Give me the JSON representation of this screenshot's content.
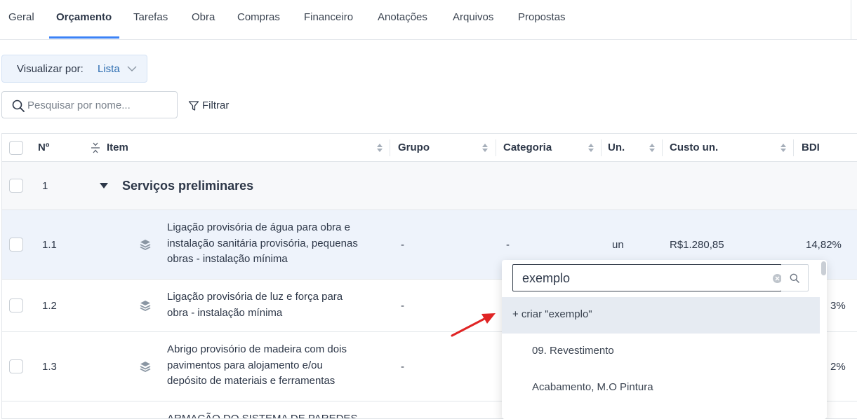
{
  "tabs": [
    {
      "label": "Geral",
      "active": false
    },
    {
      "label": "Orçamento",
      "active": true
    },
    {
      "label": "Tarefas",
      "active": false
    },
    {
      "label": "Obra",
      "active": false
    },
    {
      "label": "Compras",
      "active": false
    },
    {
      "label": "Financeiro",
      "active": false
    },
    {
      "label": "Anotações",
      "active": false
    },
    {
      "label": "Arquivos",
      "active": false
    },
    {
      "label": "Propostas",
      "active": false
    }
  ],
  "view_toggle": {
    "label": "Visualizar por:",
    "value": "Lista"
  },
  "search": {
    "placeholder": "Pesquisar por nome...",
    "value": ""
  },
  "filter": {
    "label": "Filtrar"
  },
  "table": {
    "headers": {
      "num": "Nº",
      "item": "Item",
      "grupo": "Grupo",
      "categoria": "Categoria",
      "un": "Un.",
      "custo": "Custo un.",
      "bdi": "BDI"
    },
    "group": {
      "num": "1",
      "title": "Serviços preliminares"
    },
    "rows": [
      {
        "num": "1.1",
        "lines": [
          "Ligação provisória de água para obra e",
          "instalação sanitária provisória, pequenas",
          "obras - instalação mínima"
        ],
        "grupo": "-",
        "categoria": "-",
        "un": "un",
        "custo": "R$1.280,85",
        "bdi": "14,82%"
      },
      {
        "num": "1.2",
        "lines": [
          "Ligação provisória de luz e força para",
          "obra - instalação mínima"
        ],
        "grupo": "-",
        "bdi": "3%"
      },
      {
        "num": "1.3",
        "lines": [
          "Abrigo provisório de madeira com dois",
          "pavimentos para alojamento e/ou",
          "depósito de materiais e ferramentas"
        ],
        "grupo": "-",
        "bdi": "2%"
      },
      {
        "num": "",
        "lines": [
          "ARMAÇÃO DO SISTEMA DE PAREDES"
        ]
      }
    ]
  },
  "dropdown": {
    "input_value": "exemplo",
    "create_label": "+ criar \"exemplo\"",
    "options": [
      "09. Revestimento",
      "Acabamento, M.O Pintura"
    ]
  },
  "colors": {
    "accent": "#3b82f6",
    "link": "#2b6cb0",
    "selected_row": "#eef3fb",
    "annotation_arrow": "#e02424"
  }
}
